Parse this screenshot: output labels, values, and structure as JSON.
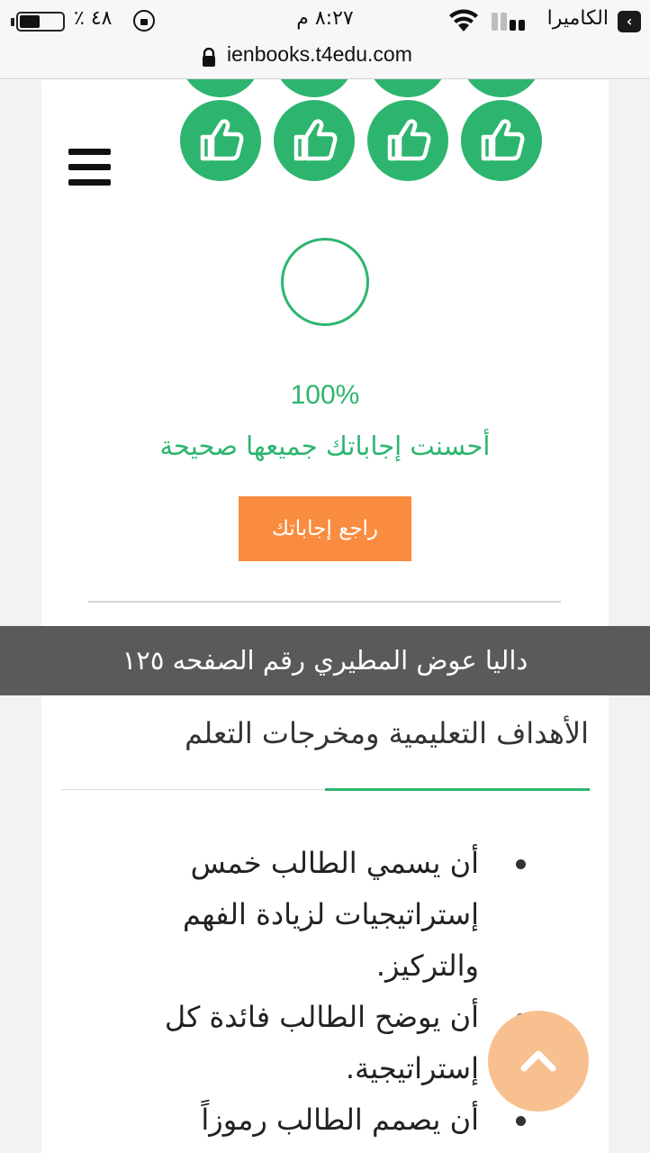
{
  "status_bar": {
    "back_app": "الكاميرا",
    "time": "٨:٢٧ م",
    "battery_percent": "٤٨ ٪",
    "battery_level": 0.48
  },
  "url_bar": {
    "url": "ienbooks.t4edu.com"
  },
  "quiz_result": {
    "percent": "100%",
    "message": "أحسنت إجاباتك جميعها صحيحة",
    "review_button": "راجع إجاباتك",
    "answered_count_visible": 8
  },
  "lesson": {
    "title": "داليا عوض المطيري رقم الصفحه ١٢٥"
  },
  "objectives": {
    "heading": "الأهداف التعليمية ومخرجات التعلم",
    "items": [
      "أن يسمي الطالب خمس إستراتيجيات لزيادة الفهم والتركيز.",
      "أن يوضح الطالب فائدة كل إستراتيجية.",
      "أن يصمم الطالب رموزاً"
    ]
  },
  "colors": {
    "accent_green": "#2db56f",
    "button_orange": "#f98c3f",
    "scroll_button": "#f9c08f",
    "title_band": "#5a5a5a"
  },
  "icons": {
    "thumbs": "thumbs-up-icon",
    "menu": "hamburger-menu-icon",
    "scroll": "chevron-up-icon"
  }
}
